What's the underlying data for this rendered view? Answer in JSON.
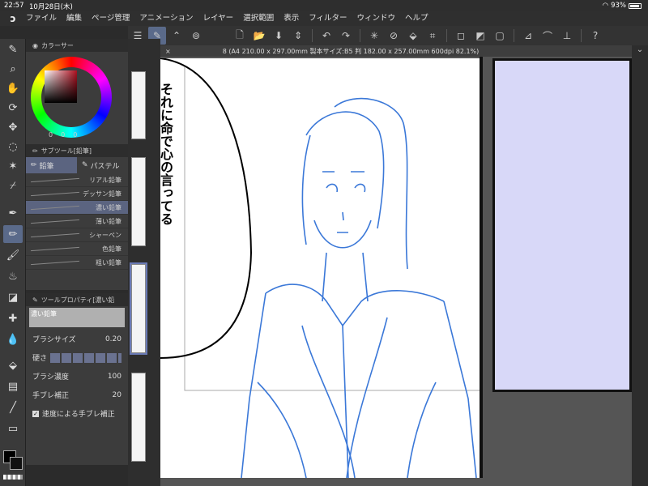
{
  "status": {
    "time": "22:57",
    "date": "10月28日(木)",
    "battery": "93%"
  },
  "menu": [
    "ファイル",
    "編集",
    "ページ管理",
    "アニメーション",
    "レイヤー",
    "選択範囲",
    "表示",
    "フィルター",
    "ウィンドウ",
    "ヘルプ"
  ],
  "color_panel": {
    "title": "カラーサー",
    "rgb": [
      "0",
      "0",
      "0"
    ]
  },
  "subtool": {
    "title": "サブツール[鉛筆]",
    "tabs": [
      "鉛筆",
      "パステル"
    ],
    "brushes": [
      "リアル鉛筆",
      "デッサン鉛筆",
      "濃い鉛筆",
      "薄い鉛筆",
      "シャーペン",
      "色鉛筆",
      "粗い鉛筆"
    ],
    "active_brush_index": 2
  },
  "tool_property": {
    "title": "ツールプロパティ[濃い鉛",
    "preview_label": "濃い鉛筆",
    "brush_size_label": "ブラシサイズ",
    "brush_size_value": "0.20",
    "hardness_label": "硬さ",
    "density_label": "ブラシ濃度",
    "density_value": "100",
    "stabilization_label": "手ブレ補正",
    "stabilization_value": "20",
    "speed_stab_label": "速度による手ブレ補正"
  },
  "canvas_tab": "8 (A4 210.00 x 297.00mm 製本サイズ:B5 判 182.00 x 257.00mm 600dpi 82.1%)",
  "speech_text": "それに命で心の言ってる"
}
